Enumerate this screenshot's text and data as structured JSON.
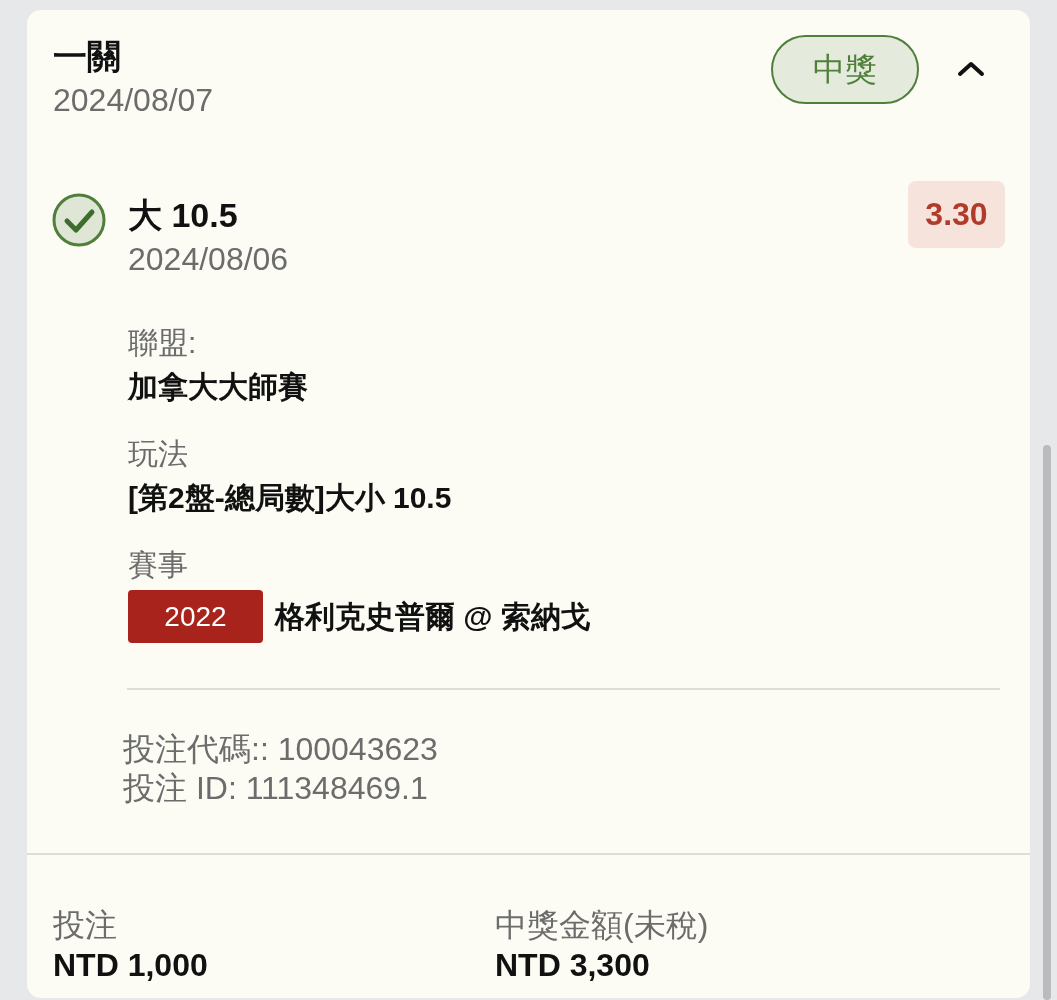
{
  "bet_card": {
    "title": "一關",
    "date": "2024/08/07",
    "status_badge": {
      "label": "中獎",
      "kind": "won"
    },
    "expanded": true,
    "selection": {
      "won": true,
      "pick": "大 10.5",
      "date": "2024/08/06",
      "odds": "3.30",
      "details": [
        {
          "kind": "text",
          "label": "聯盟:",
          "value": "加拿大大師賽"
        },
        {
          "kind": "text",
          "label": "玩法",
          "value": "[第2盤-總局數]大小 10.5"
        },
        {
          "kind": "match",
          "label": "賽事",
          "tag": "2022",
          "value": "格利克史普爾 @ 索納戈"
        }
      ]
    },
    "bet_codes": [
      "投注代碼:: 100043623",
      "投注 ID: 111348469.1"
    ],
    "summary": [
      {
        "label": "投注",
        "value": "NTD 1,000"
      },
      {
        "label": "中獎金額(未稅)",
        "value": "NTD 3,300"
      }
    ]
  }
}
